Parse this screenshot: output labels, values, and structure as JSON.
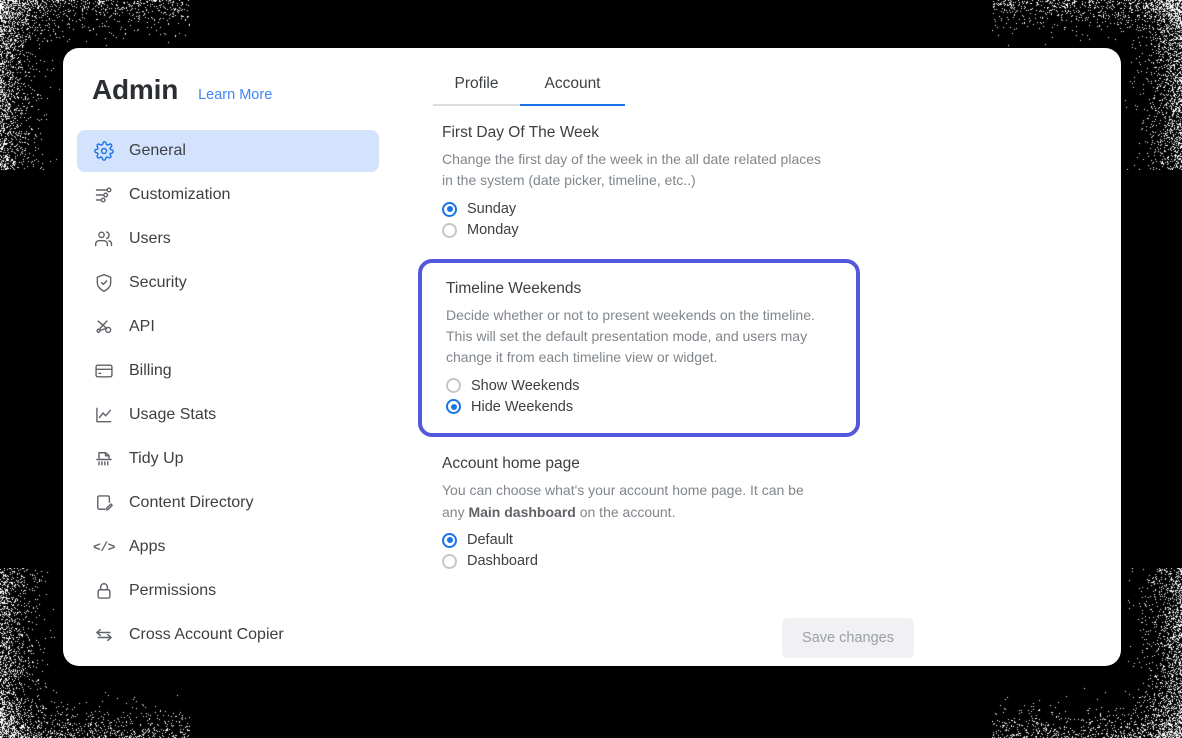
{
  "window": {
    "background_color": "#000000",
    "card_background": "#ffffff"
  },
  "header": {
    "title": "Admin",
    "learn_more_label": "Learn More"
  },
  "sidebar": {
    "items": [
      {
        "label": "General",
        "icon": "gear-icon",
        "active": true
      },
      {
        "label": "Customization",
        "icon": "sliders-icon",
        "active": false
      },
      {
        "label": "Users",
        "icon": "users-icon",
        "active": false
      },
      {
        "label": "Security",
        "icon": "shield-check-icon",
        "active": false
      },
      {
        "label": "API",
        "icon": "nodes-icon",
        "active": false
      },
      {
        "label": "Billing",
        "icon": "credit-card-icon",
        "active": false
      },
      {
        "label": "Usage Stats",
        "icon": "chart-line-icon",
        "active": false
      },
      {
        "label": "Tidy Up",
        "icon": "shredder-icon",
        "active": false
      },
      {
        "label": "Content Directory",
        "icon": "page-pencil-icon",
        "active": false
      },
      {
        "label": "Apps",
        "icon": "code-brackets-icon",
        "active": false
      },
      {
        "label": "Permissions",
        "icon": "lock-icon",
        "active": false
      },
      {
        "label": "Cross Account Copier",
        "icon": "transfer-arrows-icon",
        "active": false
      }
    ]
  },
  "tabs": [
    {
      "label": "Profile",
      "active": false
    },
    {
      "label": "Account",
      "active": true
    }
  ],
  "settings": {
    "first_day_of_week": {
      "title": "First Day Of The Week",
      "description": "Change the first day of the week in the all date related places in the system (date picker, timeline, etc..)",
      "options": [
        {
          "label": "Sunday",
          "selected": true
        },
        {
          "label": "Monday",
          "selected": false
        }
      ]
    },
    "timeline_weekends": {
      "title": "Timeline Weekends",
      "description": "Decide whether or not to present weekends on the timeline. This will set the default presentation mode, and users may change it from each timeline view or widget.",
      "highlighted": true,
      "highlight_color": "#5257db",
      "options": [
        {
          "label": "Show Weekends",
          "selected": false
        },
        {
          "label": "Hide Weekends",
          "selected": true
        }
      ]
    },
    "account_home_page": {
      "title": "Account home page",
      "description_part1": "You can choose what's your account home page. It can be any ",
      "description_bold": "Main dashboard",
      "description_part2": " on the account.",
      "options": [
        {
          "label": "Default",
          "selected": true
        },
        {
          "label": "Dashboard",
          "selected": false
        }
      ]
    }
  },
  "footer": {
    "save_label": "Save changes",
    "save_disabled": true
  },
  "colors": {
    "accent_blue": "#1a73e8",
    "link_blue": "#4285f4",
    "active_nav_bg": "#d3e3fd",
    "highlight_purple": "#5257db",
    "muted_text": "#80868b"
  }
}
